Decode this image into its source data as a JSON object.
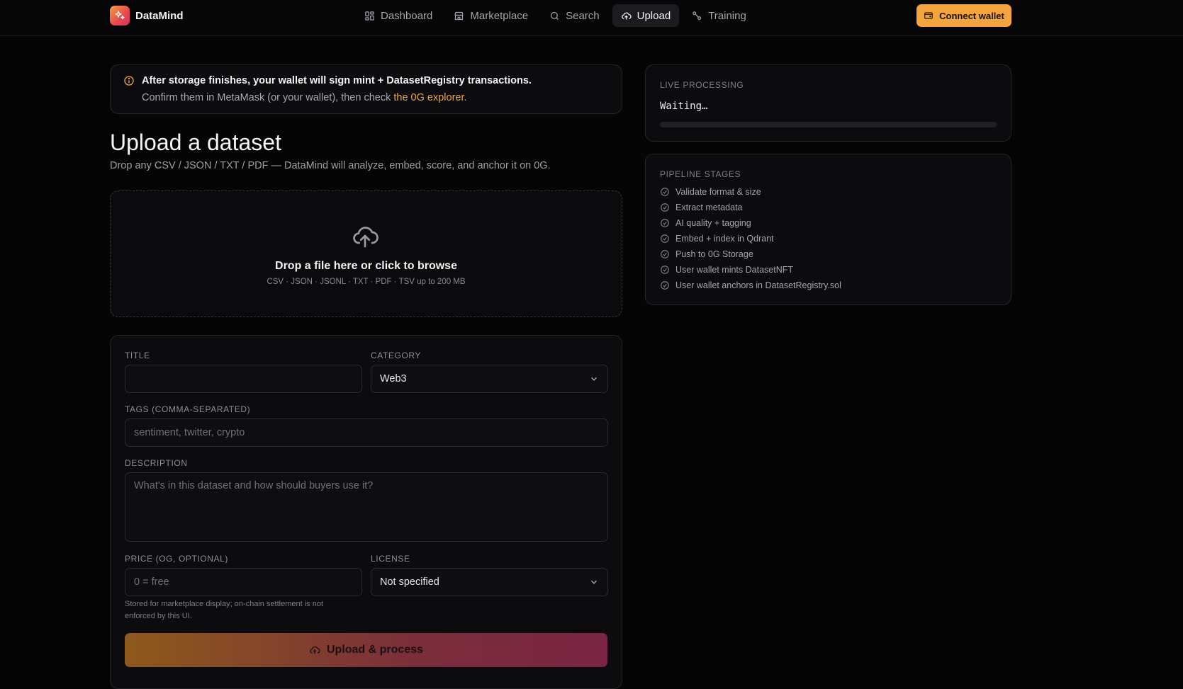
{
  "app": {
    "name": "DataMind"
  },
  "nav": {
    "items": [
      {
        "label": "Dashboard",
        "icon": "dashboard-icon",
        "active": false
      },
      {
        "label": "Marketplace",
        "icon": "store-icon",
        "active": false
      },
      {
        "label": "Search",
        "icon": "search-icon",
        "active": false
      },
      {
        "label": "Upload",
        "icon": "cloud-upload-icon",
        "active": true
      },
      {
        "label": "Training",
        "icon": "training-icon",
        "active": false
      }
    ],
    "connect_label": "Connect wallet"
  },
  "notice": {
    "title": "After storage finishes, your wallet will sign mint + DatasetRegistry transactions.",
    "body": "Confirm them in MetaMask (or your wallet), then check ",
    "link": "the 0G explorer",
    "end": "."
  },
  "page": {
    "title": "Upload a dataset",
    "subtitle": "Drop any CSV / JSON / TXT / PDF — DataMind will analyze, embed, score, and anchor it on 0G."
  },
  "dropzone": {
    "title": "Drop a file here or click to browse",
    "formats": "CSV · JSON · JSONL · TXT · PDF · TSV up to 200 MB"
  },
  "form": {
    "title_label": "TITLE",
    "title_value": "",
    "category_label": "CATEGORY",
    "category_value": "Web3",
    "tags_label": "TAGS (COMMA-SEPARATED)",
    "tags_placeholder": "sentiment, twitter, crypto",
    "description_label": "DESCRIPTION",
    "description_placeholder": "What's in this dataset and how should buyers use it?",
    "price_label": "PRICE (OG, OPTIONAL)",
    "price_placeholder": "0 = free",
    "price_help_1": "Stored for marketplace display; on-chain settlement is not",
    "price_help_2": "enforced by this UI.",
    "license_label": "LICENSE",
    "license_value": "Not specified",
    "submit_label": "Upload & process"
  },
  "live": {
    "label": "LIVE PROCESSING",
    "status": "Waiting…",
    "progress": 0
  },
  "pipeline": {
    "label": "PIPELINE STAGES",
    "stages": [
      "Validate format & size",
      "Extract metadata",
      "AI quality + tagging",
      "Embed + index in Qdrant",
      "Push to 0G Storage",
      "User wallet mints DatasetNFT",
      "User wallet anchors in DatasetRegistry.sol"
    ]
  },
  "colors": {
    "accent": "#f4a43a",
    "background": "#050506"
  }
}
